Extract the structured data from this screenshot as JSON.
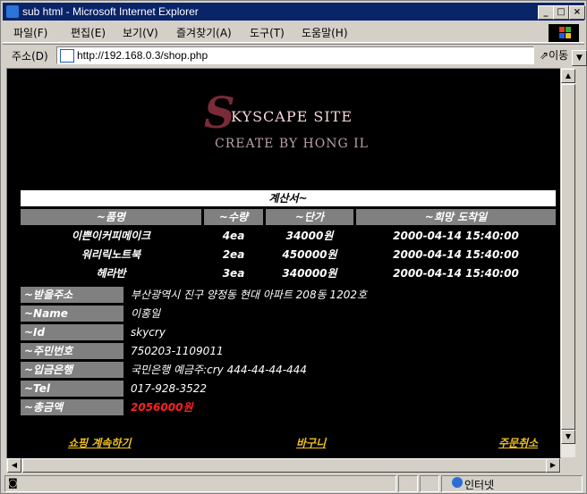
{
  "window": {
    "title": "sub html - Microsoft Internet Explorer",
    "buttons": {
      "minimize": "_",
      "maximize": "□",
      "close": "×"
    }
  },
  "menu": [
    "파일(F)",
    "편집(E)",
    "보기(V)",
    "즐겨찾기(A)",
    "도구(T)",
    "도움말(H)"
  ],
  "address": {
    "label": "주소(D)",
    "url": "http://192.168.0.3/shop.php",
    "go_label": "이동"
  },
  "page": {
    "logo": {
      "line1": "KYSCAPE SITE",
      "initial": "S",
      "line2": "CREATE BY HONG IL"
    },
    "bill_title": "계산서~",
    "columns": [
      "~품명",
      "~수량",
      "~단가",
      "~희망 도착일"
    ],
    "items": [
      {
        "name": "이쁜이커피메이크",
        "qty": "4ea",
        "price": "34000원",
        "date": "2000-04-14 15:40:00"
      },
      {
        "name": "워리릭노트북",
        "qty": "2ea",
        "price": "450000원",
        "date": "2000-04-14 15:40:00"
      },
      {
        "name": "헤라반",
        "qty": "3ea",
        "price": "340000원",
        "date": "2000-04-14 15:40:00"
      }
    ],
    "info": [
      {
        "label": "~받을주소",
        "value": "부산광역시 진구 양정동 현대 아파트 208동 1202호"
      },
      {
        "label": "~Name",
        "value": "이홍일"
      },
      {
        "label": "~Id",
        "value": "skycry"
      },
      {
        "label": "~주민번호",
        "value": "750203-1109011"
      },
      {
        "label": "~입금은행",
        "value": "국민은행 예금주:cry 444-44-44-444"
      },
      {
        "label": "~Tel",
        "value": "017-928-3522"
      },
      {
        "label": "~총금액",
        "value": "2056000원"
      }
    ],
    "links": {
      "continue": "쇼핑 계속하기",
      "cart": "바구니",
      "cancel": "주문취소"
    }
  },
  "status": {
    "zone": "인터넷"
  },
  "colors": {
    "title_bar": "#0a246a",
    "page_bg": "#000000",
    "header_gray": "#808080",
    "link": "#f0c020",
    "total": "#ff2020"
  }
}
